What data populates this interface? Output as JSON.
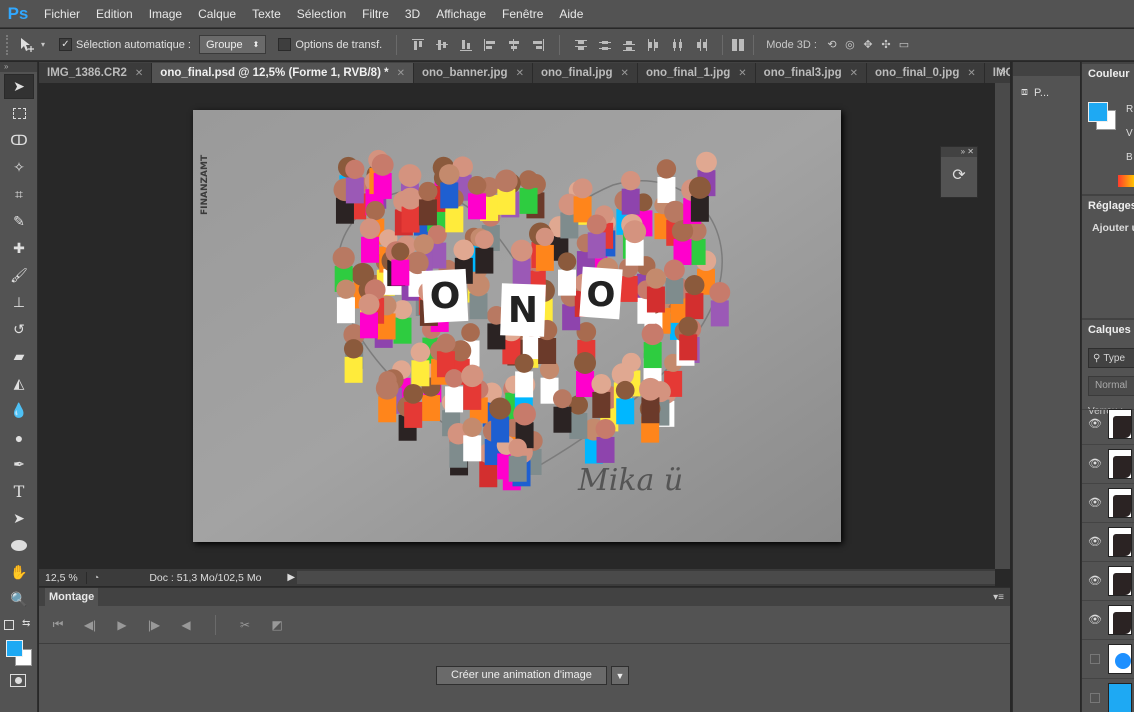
{
  "app": {
    "logo": "Ps"
  },
  "menu": [
    "Fichier",
    "Edition",
    "Image",
    "Calque",
    "Texte",
    "Sélection",
    "Filtre",
    "3D",
    "Affichage",
    "Fenêtre",
    "Aide"
  ],
  "options": {
    "auto_select_label": "Sélection automatique :",
    "auto_select_value": "Groupe",
    "transform_label": "Options de transf.",
    "mode3d_label": "Mode 3D :"
  },
  "tabs": [
    {
      "label": "IMG_1386.CR2",
      "active": false
    },
    {
      "label": "ono_final.psd @ 12,5% (Forme 1, RVB/8) *",
      "active": true
    },
    {
      "label": "ono_banner.jpg",
      "active": false
    },
    {
      "label": "ono_final.jpg",
      "active": false
    },
    {
      "label": "ono_final_1.jpg",
      "active": false
    },
    {
      "label": "ono_final3.jpg",
      "active": false
    },
    {
      "label": "ono_final_0.jpg",
      "active": false
    },
    {
      "label": "IMG",
      "active": false
    }
  ],
  "canvas": {
    "stamp_text": "FINANZAMT",
    "letters": [
      "O",
      "N",
      "O"
    ],
    "signature": "Mika ü"
  },
  "status": {
    "zoom": "12,5 %",
    "doc": "Doc : 51,3 Mo/102,5 Mo"
  },
  "timeline": {
    "title": "Montage",
    "create_button": "Créer une animation d'image"
  },
  "right_narrow": {
    "item_label": "P..."
  },
  "panels": {
    "color_title": "Couleur",
    "color_channels": [
      "R",
      "V",
      "B"
    ],
    "adjust_title": "Réglages",
    "adjust_text": "Ajouter u",
    "layers_title": "Calques",
    "layers_filter": "Type",
    "layers_blend": "Normal",
    "layers_lock": "Verrou :"
  },
  "colors": {
    "foreground": "#1ea9f3",
    "background": "#ffffff",
    "ui": "#535353"
  }
}
